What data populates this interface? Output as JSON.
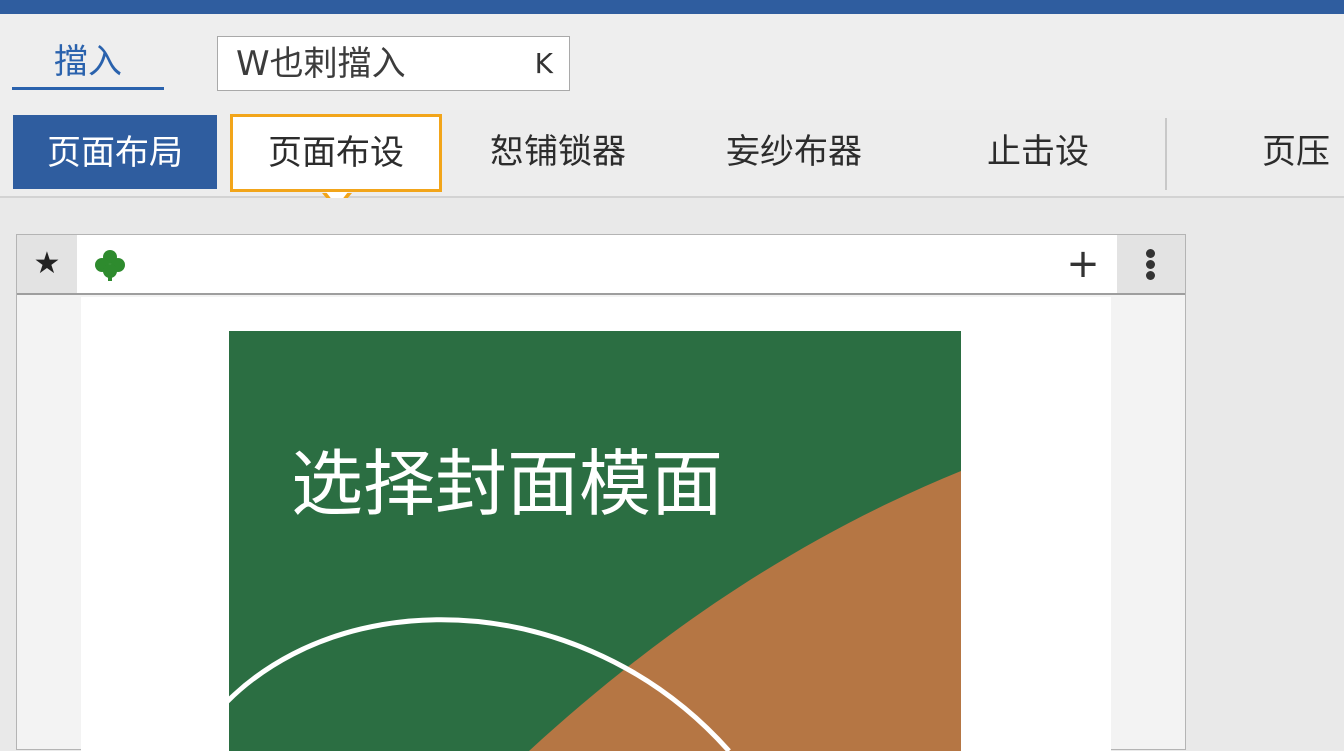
{
  "colors": {
    "accent_blue": "#2f5d9f",
    "highlight_orange": "#f2a51a",
    "cover_green": "#2b6e42",
    "cover_brown": "#b57644"
  },
  "ribbon": {
    "insert_tab": "擋入",
    "search": {
      "value": "W也剌擋入",
      "icon": "collapse-icon",
      "icon_glyph": "K"
    },
    "tabs": [
      {
        "label": "页面布局",
        "state": "active"
      },
      {
        "label": "页面布设",
        "state": "highlighted"
      },
      {
        "label": "恕铺锁器",
        "state": "normal"
      },
      {
        "label": "妄纱布器",
        "state": "normal"
      },
      {
        "label": "止击设",
        "state": "normal"
      },
      {
        "label": "页压",
        "state": "normal"
      }
    ]
  },
  "panel_toolbar": {
    "star_glyph": "★",
    "clover_icon": "clover-icon",
    "plus_glyph": "+",
    "more_icon": "vertical-ellipsis-icon"
  },
  "cover": {
    "title": "选择封面模面"
  }
}
